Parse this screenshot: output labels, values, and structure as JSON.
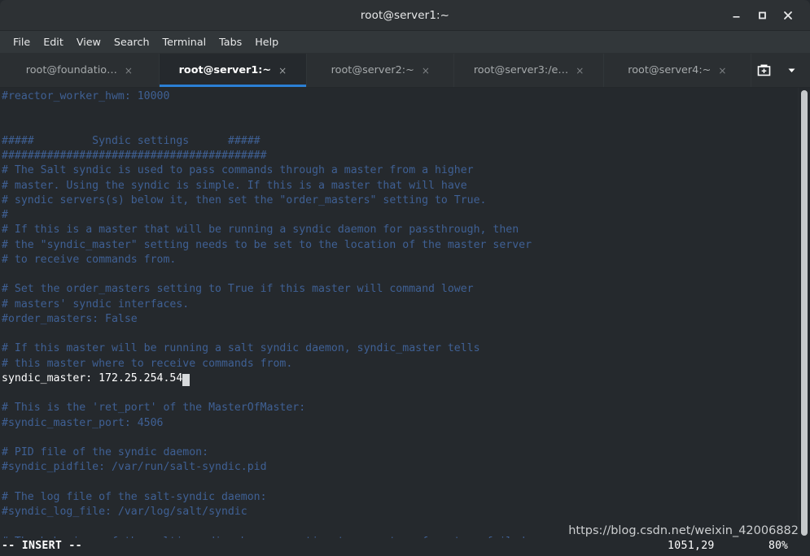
{
  "window": {
    "title": "root@server1:~",
    "controls": {
      "minimize": "minimize-window",
      "maximize": "maximize-window",
      "close": "close-window"
    }
  },
  "menubar": {
    "items": [
      {
        "label": "File"
      },
      {
        "label": "Edit"
      },
      {
        "label": "View"
      },
      {
        "label": "Search"
      },
      {
        "label": "Terminal"
      },
      {
        "label": "Tabs"
      },
      {
        "label": "Help"
      }
    ]
  },
  "tabbar": {
    "tabs": [
      {
        "label": "root@foundatio…",
        "close": "×",
        "active": false
      },
      {
        "label": "root@server1:~",
        "close": "×",
        "active": true
      },
      {
        "label": "root@server2:~",
        "close": "×",
        "active": false
      },
      {
        "label": "root@server3:/e…",
        "close": "×",
        "active": false
      },
      {
        "label": "root@server4:~",
        "close": "×",
        "active": false
      }
    ],
    "new_tab_icon": "new-tab-icon",
    "tab_menu_icon": "chevron-down-icon",
    "active_underline_color": "#2b7fd4"
  },
  "terminal": {
    "background_color": "#25292d",
    "comment_color": "#3f6094",
    "text_color": "#ffffff",
    "cursor_color": "#d7dadc",
    "lines": [
      {
        "text": "#reactor_worker_hwm: 10000",
        "highlight": false
      },
      {
        "text": "",
        "highlight": false
      },
      {
        "text": "",
        "highlight": false
      },
      {
        "text": "#####         Syndic settings      #####",
        "highlight": false
      },
      {
        "text": "#########################################",
        "highlight": false
      },
      {
        "text": "# The Salt syndic is used to pass commands through a master from a higher",
        "highlight": false
      },
      {
        "text": "# master. Using the syndic is simple. If this is a master that will have",
        "highlight": false
      },
      {
        "text": "# syndic servers(s) below it, then set the \"order_masters\" setting to True.",
        "highlight": false
      },
      {
        "text": "#",
        "highlight": false
      },
      {
        "text": "# If this is a master that will be running a syndic daemon for passthrough, then",
        "highlight": false
      },
      {
        "text": "# the \"syndic_master\" setting needs to be set to the location of the master server",
        "highlight": false
      },
      {
        "text": "# to receive commands from.",
        "highlight": false
      },
      {
        "text": "",
        "highlight": false
      },
      {
        "text": "# Set the order_masters setting to True if this master will command lower",
        "highlight": false
      },
      {
        "text": "# masters' syndic interfaces.",
        "highlight": false
      },
      {
        "text": "#order_masters: False",
        "highlight": false
      },
      {
        "text": "",
        "highlight": false
      },
      {
        "text": "# If this master will be running a salt syndic daemon, syndic_master tells",
        "highlight": false
      },
      {
        "text": "# this master where to receive commands from.",
        "highlight": false
      },
      {
        "text": "syndic_master: 172.25.254.54",
        "highlight": true,
        "cursor": true
      },
      {
        "text": "",
        "highlight": false
      },
      {
        "text": "# This is the 'ret_port' of the MasterOfMaster:",
        "highlight": false
      },
      {
        "text": "#syndic_master_port: 4506",
        "highlight": false
      },
      {
        "text": "",
        "highlight": false
      },
      {
        "text": "# PID file of the syndic daemon:",
        "highlight": false
      },
      {
        "text": "#syndic_pidfile: /var/run/salt-syndic.pid",
        "highlight": false
      },
      {
        "text": "",
        "highlight": false
      },
      {
        "text": "# The log file of the salt-syndic daemon:",
        "highlight": false
      },
      {
        "text": "#syndic_log_file: /var/log/salt/syndic",
        "highlight": false
      },
      {
        "text": "",
        "highlight": false
      },
      {
        "text": "# The behaviour of the multi-syndic when connection to a master of masters failed.",
        "highlight": false
      }
    ]
  },
  "statusbar": {
    "mode": "-- INSERT --",
    "position": "1051,29",
    "percent": "80%"
  },
  "watermark": {
    "text": "https://blog.csdn.net/weixin_42006882"
  }
}
